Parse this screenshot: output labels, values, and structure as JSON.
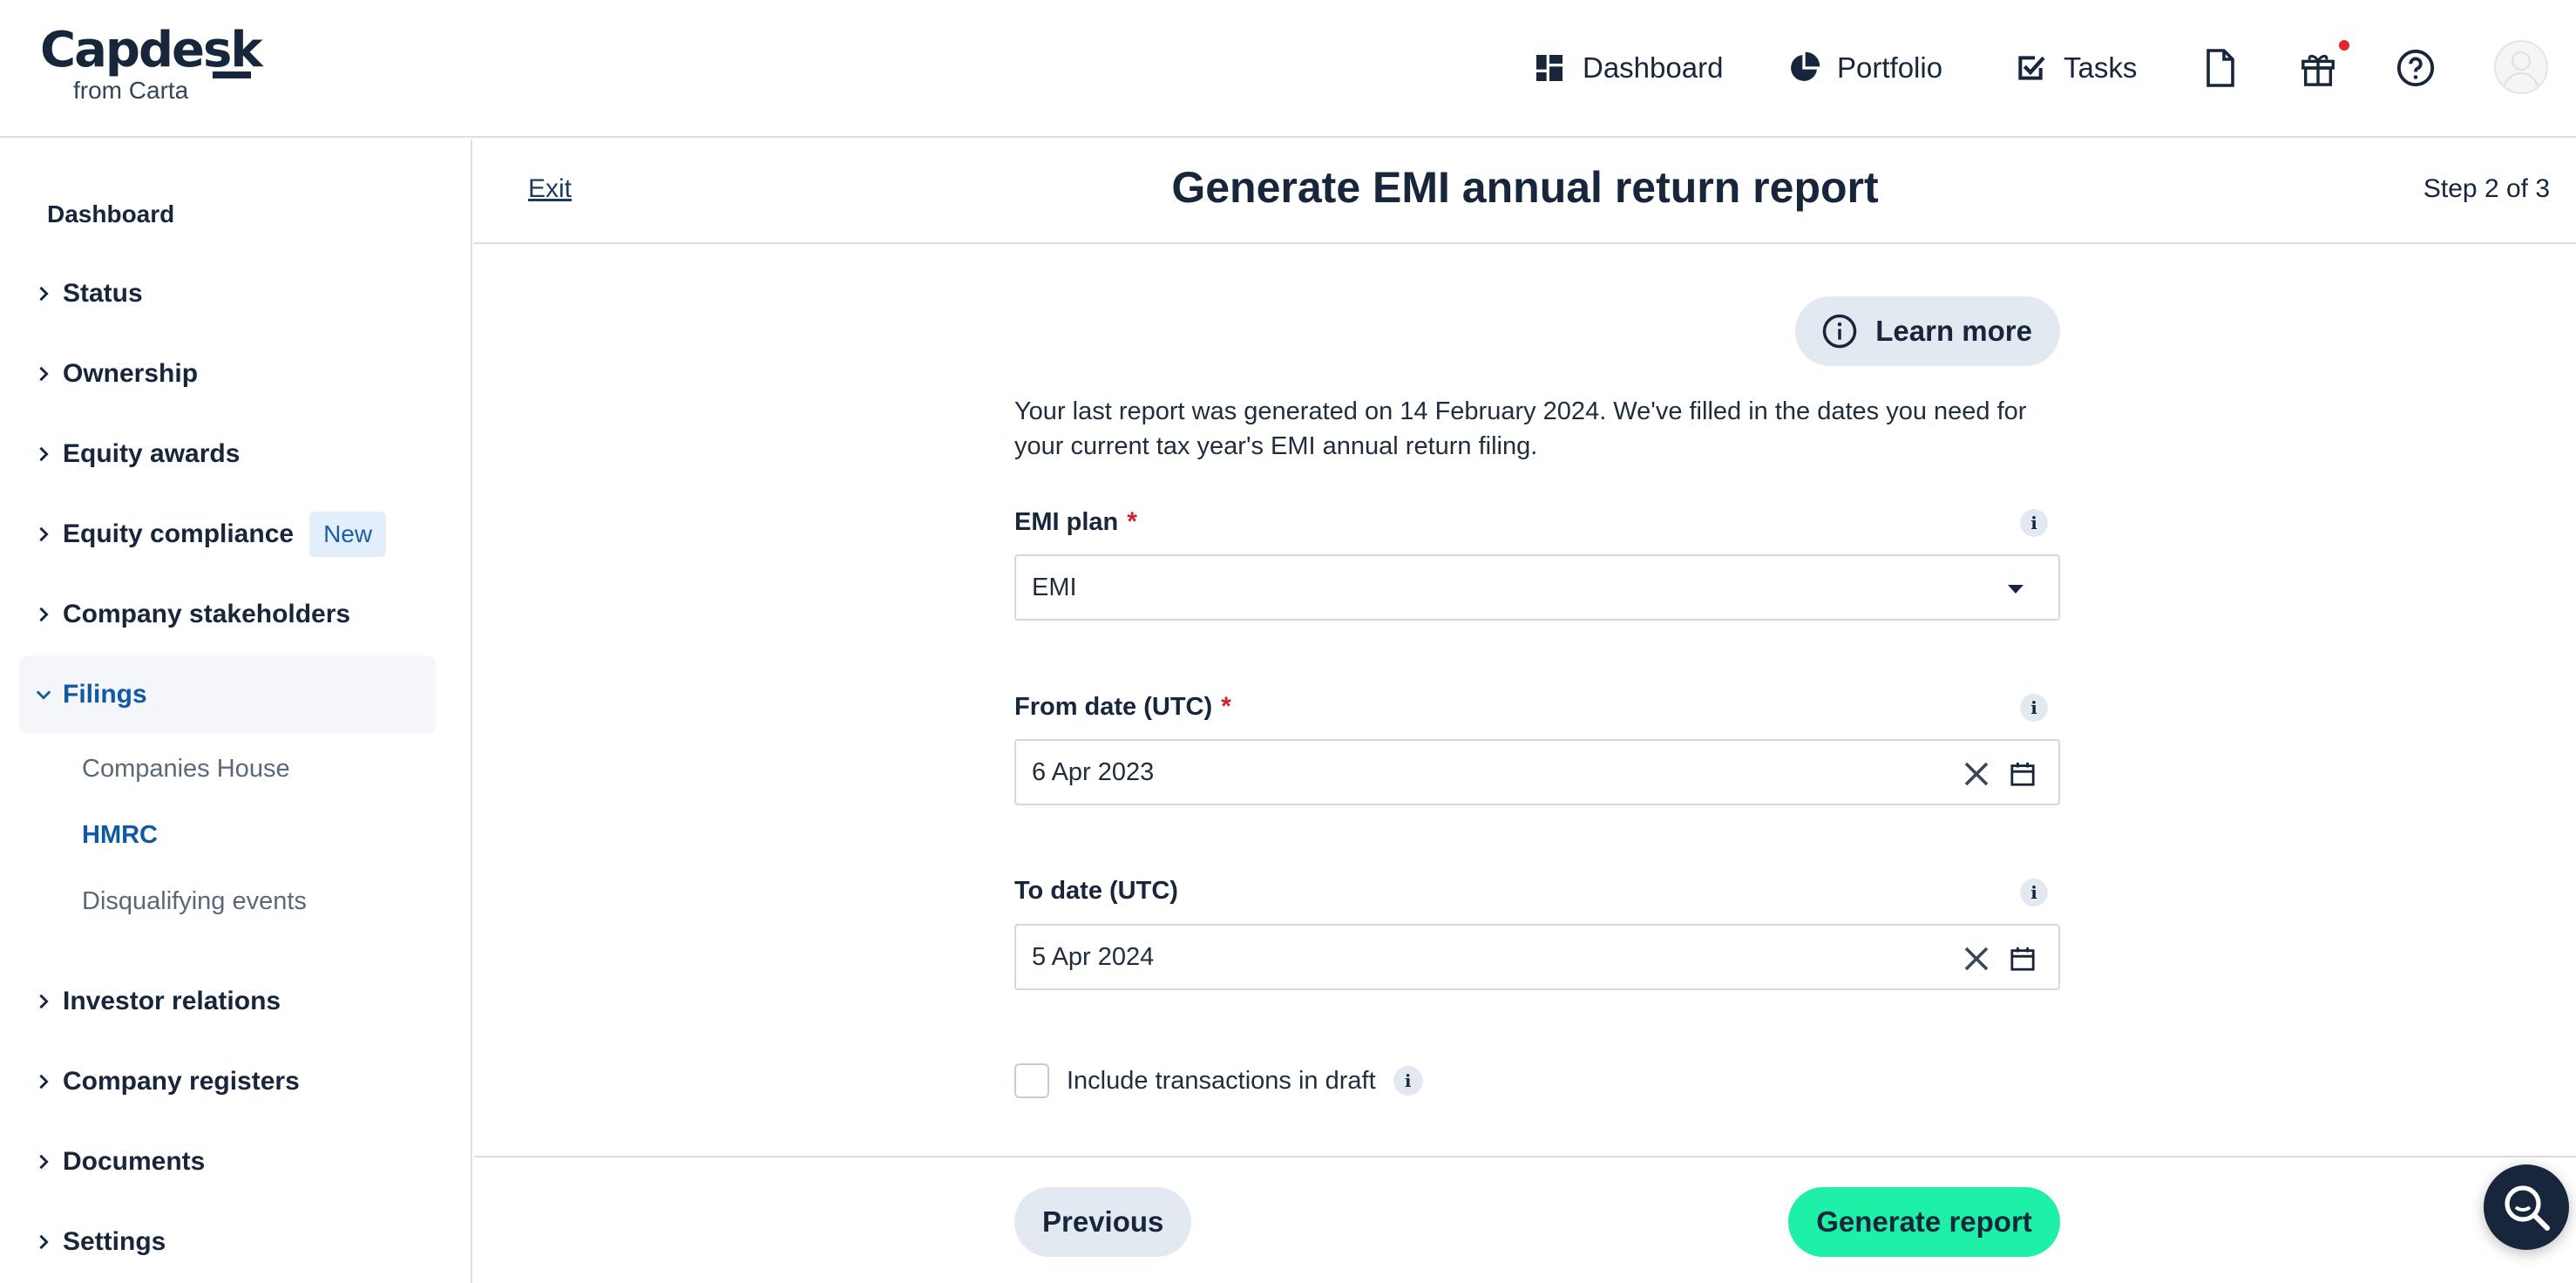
{
  "brand": {
    "name": "Capdesk",
    "subtitle": "from Carta"
  },
  "topnav": {
    "dashboard": "Dashboard",
    "portfolio": "Portfolio",
    "tasks": "Tasks"
  },
  "icons": {
    "documents": "document-icon",
    "gifts": "gift-icon",
    "help": "help-icon",
    "avatar": "avatar"
  },
  "sidebar": {
    "title": "Dashboard",
    "items": [
      {
        "label": "Status"
      },
      {
        "label": "Ownership"
      },
      {
        "label": "Equity awards"
      },
      {
        "label": "Equity compliance",
        "badge": "New"
      },
      {
        "label": "Company stakeholders"
      },
      {
        "label": "Filings"
      },
      {
        "label": "Investor relations"
      },
      {
        "label": "Company registers"
      },
      {
        "label": "Documents"
      },
      {
        "label": "Settings"
      }
    ],
    "filings_sub": [
      "Companies House",
      "HMRC",
      "Disqualifying events"
    ]
  },
  "header": {
    "exit": "Exit",
    "title": "Generate EMI annual return report",
    "step": "Step 2 of 3"
  },
  "form": {
    "learn_more": "Learn more",
    "intro": "Your last report was generated on 14 February 2024. We've filled in the dates you need for your current tax year's EMI annual return filing.",
    "emi_plan": {
      "label": "EMI plan",
      "value": "EMI",
      "required_mark": "*"
    },
    "from_date": {
      "label": "From date (UTC)",
      "value": "6 Apr 2023",
      "required_mark": "*"
    },
    "to_date": {
      "label": "To date (UTC)",
      "value": "5 Apr 2024"
    },
    "include_draft": {
      "label": "Include transactions in draft",
      "checked": false
    },
    "info_glyph": "i"
  },
  "footer": {
    "previous": "Previous",
    "generate": "Generate report"
  },
  "colors": {
    "accent": "#1ef0a8",
    "active_nav": "#0f5aa3",
    "badge_bg": "#e3f0fb",
    "required": "#d0212a"
  }
}
